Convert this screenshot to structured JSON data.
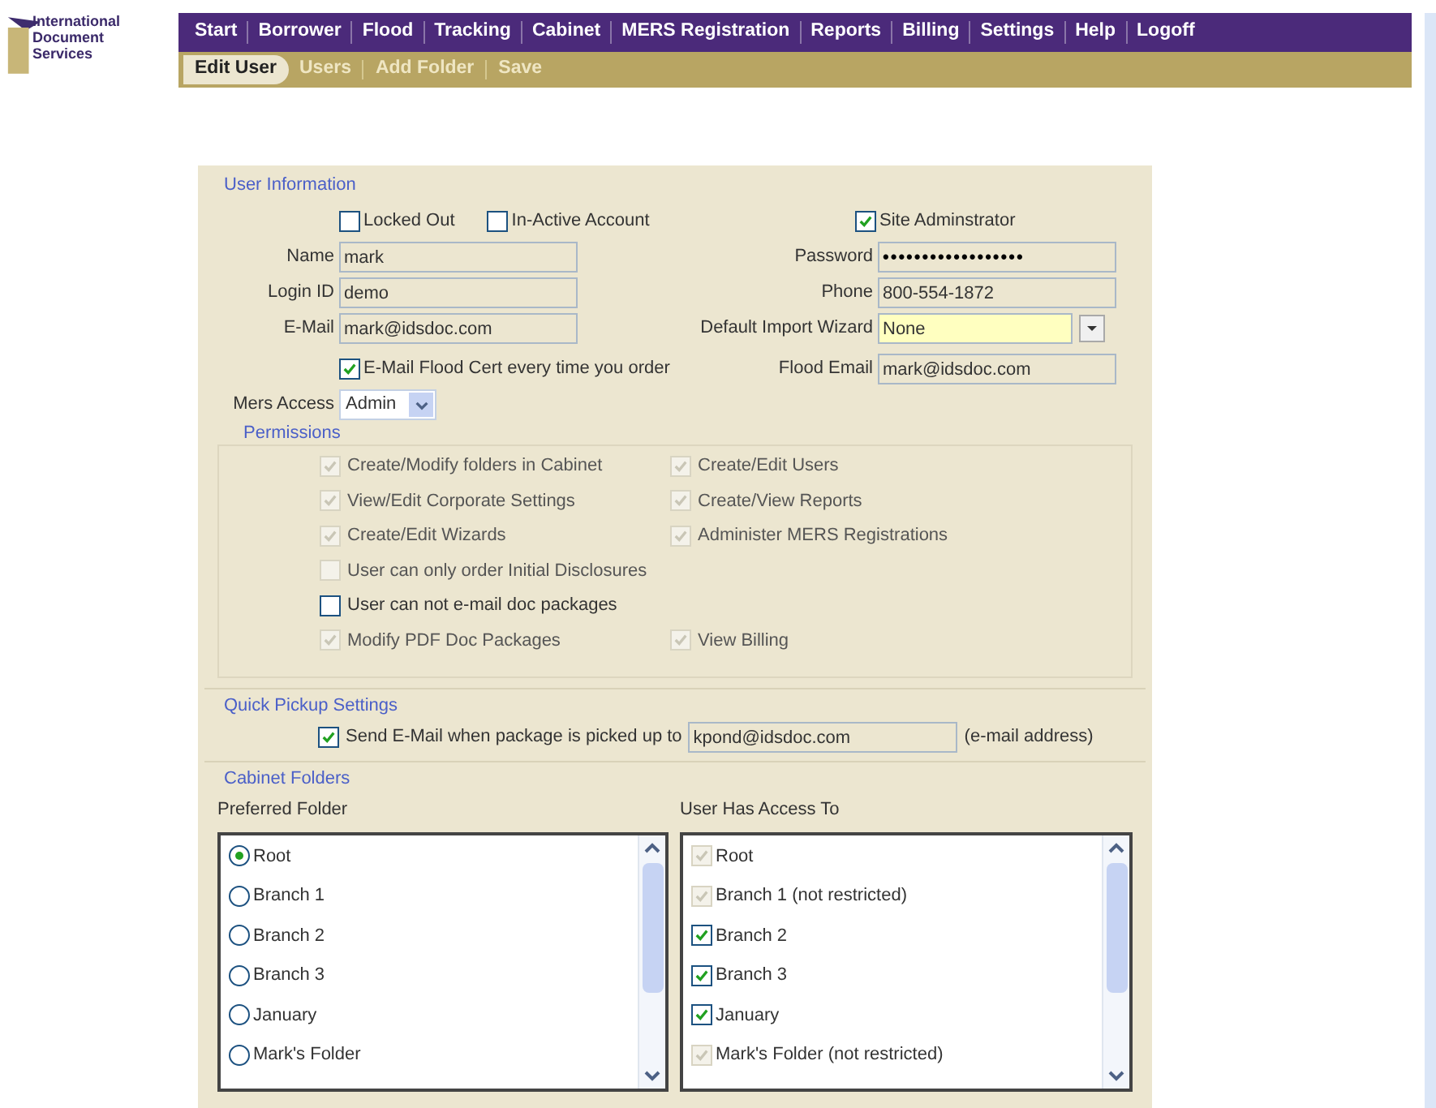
{
  "logo": {
    "lines": [
      "International",
      "Document",
      "Services"
    ]
  },
  "nav": [
    {
      "label": "Start"
    },
    {
      "label": "Borrower"
    },
    {
      "label": "Flood"
    },
    {
      "label": "Tracking"
    },
    {
      "label": "Cabinet"
    },
    {
      "label": "MERS Registration"
    },
    {
      "label": "Reports"
    },
    {
      "label": "Billing"
    },
    {
      "label": "Settings"
    },
    {
      "label": "Help"
    },
    {
      "label": "Logoff"
    }
  ],
  "subnav": [
    {
      "label": "Edit User",
      "selected": true
    },
    {
      "label": "Users",
      "selected": false
    },
    {
      "label": "Add Folder",
      "selected": false
    },
    {
      "label": "Save",
      "selected": false
    }
  ],
  "user_info": {
    "title": "User Information",
    "flags": [
      {
        "label": "Locked Out",
        "checked": false
      },
      {
        "label": "In-Active Account",
        "checked": false
      },
      {
        "label": "Site Adminstrator",
        "checked": true
      }
    ],
    "left_fields": [
      {
        "label": "Name",
        "value": "mark"
      },
      {
        "label": "Login ID",
        "value": "demo"
      },
      {
        "label": "E-Mail",
        "value": "mark@idsdoc.com"
      }
    ],
    "right_fields": [
      {
        "label": "Password",
        "value": "••••••••••••••••••",
        "kind": "password"
      },
      {
        "label": "Phone",
        "value": "800-554-1872",
        "kind": "text"
      },
      {
        "label": "Default Import Wizard",
        "value": "None",
        "kind": "select"
      }
    ],
    "flood_cert": {
      "label": "E-Mail Flood Cert every time you order",
      "checked": true
    },
    "flood_email": {
      "label": "Flood Email",
      "value": "mark@idsdoc.com"
    },
    "mers_access": {
      "label": "Mers Access",
      "value": "Admin"
    }
  },
  "permissions": {
    "title": "Permissions",
    "rows": [
      [
        {
          "label": "Create/Modify folders in Cabinet",
          "checked": true,
          "disabled": true
        },
        {
          "label": "Create/Edit Users",
          "checked": true,
          "disabled": true
        }
      ],
      [
        {
          "label": "View/Edit Corporate Settings",
          "checked": true,
          "disabled": true
        },
        {
          "label": "Create/View Reports",
          "checked": true,
          "disabled": true
        }
      ],
      [
        {
          "label": "Create/Edit Wizards",
          "checked": true,
          "disabled": true
        },
        {
          "label": "Administer MERS Registrations",
          "checked": true,
          "disabled": true
        }
      ],
      [
        {
          "label": "User can only order Initial Disclosures",
          "checked": false,
          "disabled": true
        }
      ],
      [
        {
          "label": "User can not e-mail doc packages",
          "checked": false,
          "disabled": false
        }
      ],
      [
        {
          "label": "Modify PDF Doc Packages",
          "checked": true,
          "disabled": true
        },
        {
          "label": "View Billing",
          "checked": true,
          "disabled": true
        }
      ]
    ]
  },
  "quick_pickup": {
    "title": "Quick Pickup Settings",
    "checkbox": {
      "label": "Send E-Mail when package is picked up to",
      "checked": true
    },
    "value": "kpond@idsdoc.com",
    "hint": "(e-mail address)"
  },
  "cabinet": {
    "title": "Cabinet Folders",
    "preferred": {
      "label": "Preferred Folder",
      "items": [
        {
          "label": "Root",
          "selected": true
        },
        {
          "label": "Branch 1",
          "selected": false
        },
        {
          "label": "Branch 2",
          "selected": false
        },
        {
          "label": "Branch 3",
          "selected": false
        },
        {
          "label": "January",
          "selected": false
        },
        {
          "label": "Mark's Folder",
          "selected": false
        }
      ]
    },
    "access": {
      "label": "User Has Access To",
      "items": [
        {
          "label": "Root",
          "checked": true,
          "disabled": true
        },
        {
          "label": "Branch 1 (not restricted)",
          "checked": true,
          "disabled": true
        },
        {
          "label": "Branch 2",
          "checked": true,
          "disabled": false
        },
        {
          "label": "Branch 3",
          "checked": true,
          "disabled": false
        },
        {
          "label": "January",
          "checked": true,
          "disabled": false
        },
        {
          "label": "Mark's Folder (not restricted)",
          "checked": true,
          "disabled": true
        }
      ]
    }
  }
}
